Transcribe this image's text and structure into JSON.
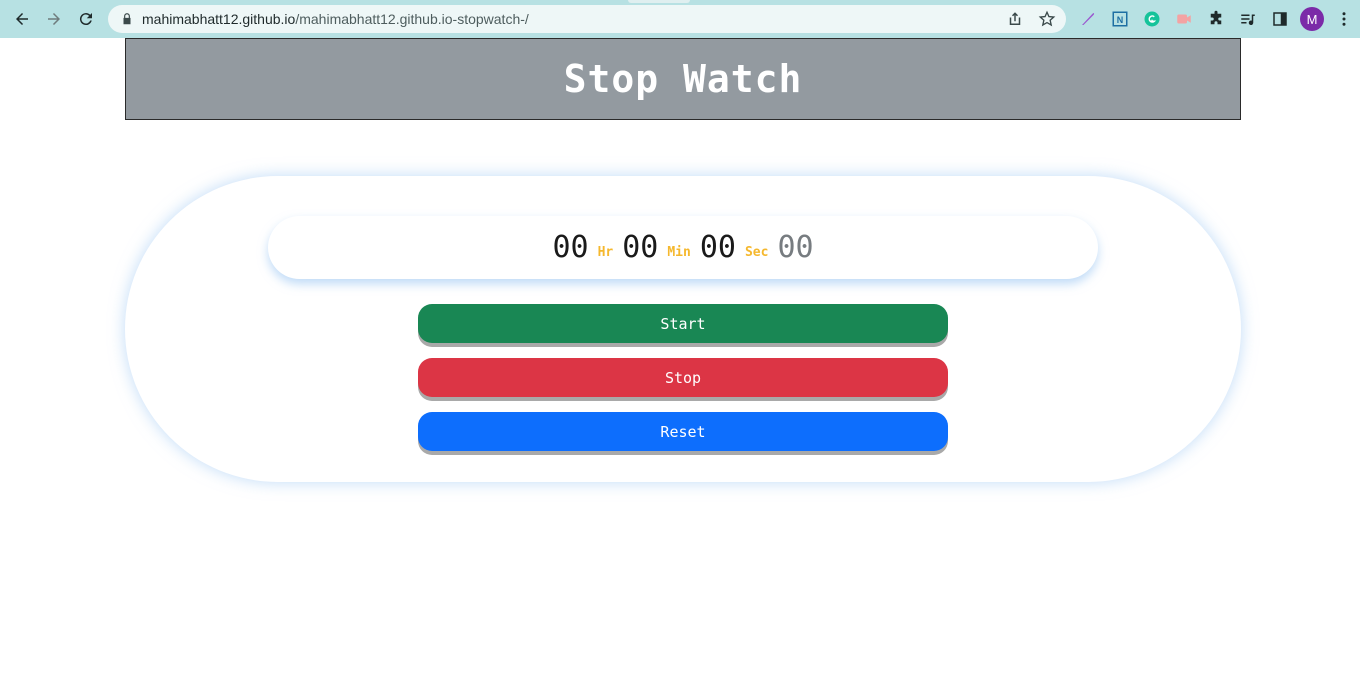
{
  "browser": {
    "url_host": "mahimabhatt12.github.io",
    "url_path": "/mahimabhatt12.github.io-stopwatch-/",
    "profile_initial": "M",
    "icons": [
      "back-icon",
      "forward-icon",
      "reload-icon",
      "lock-icon",
      "share-icon",
      "star-icon",
      "feather-extension-icon",
      "notion-extension-icon",
      "grammarly-extension-icon",
      "screencast-extension-icon",
      "puzzle-extensions-icon",
      "media-queue-icon",
      "side-panel-icon",
      "kebab-menu-icon"
    ]
  },
  "page": {
    "title": "Stop Watch"
  },
  "stopwatch": {
    "hours": "00",
    "hours_unit": "Hr",
    "minutes": "00",
    "minutes_unit": "Min",
    "seconds": "00",
    "seconds_unit": "Sec",
    "centiseconds": "00"
  },
  "buttons": {
    "start_label": "Start",
    "stop_label": "Stop",
    "reset_label": "Reset"
  },
  "colors": {
    "browser_bar": "#b7e1e3",
    "header": "#939aa0",
    "unit_text": "#f5b82e",
    "start": "#198754",
    "stop": "#dc3545",
    "reset": "#0d6efd"
  }
}
